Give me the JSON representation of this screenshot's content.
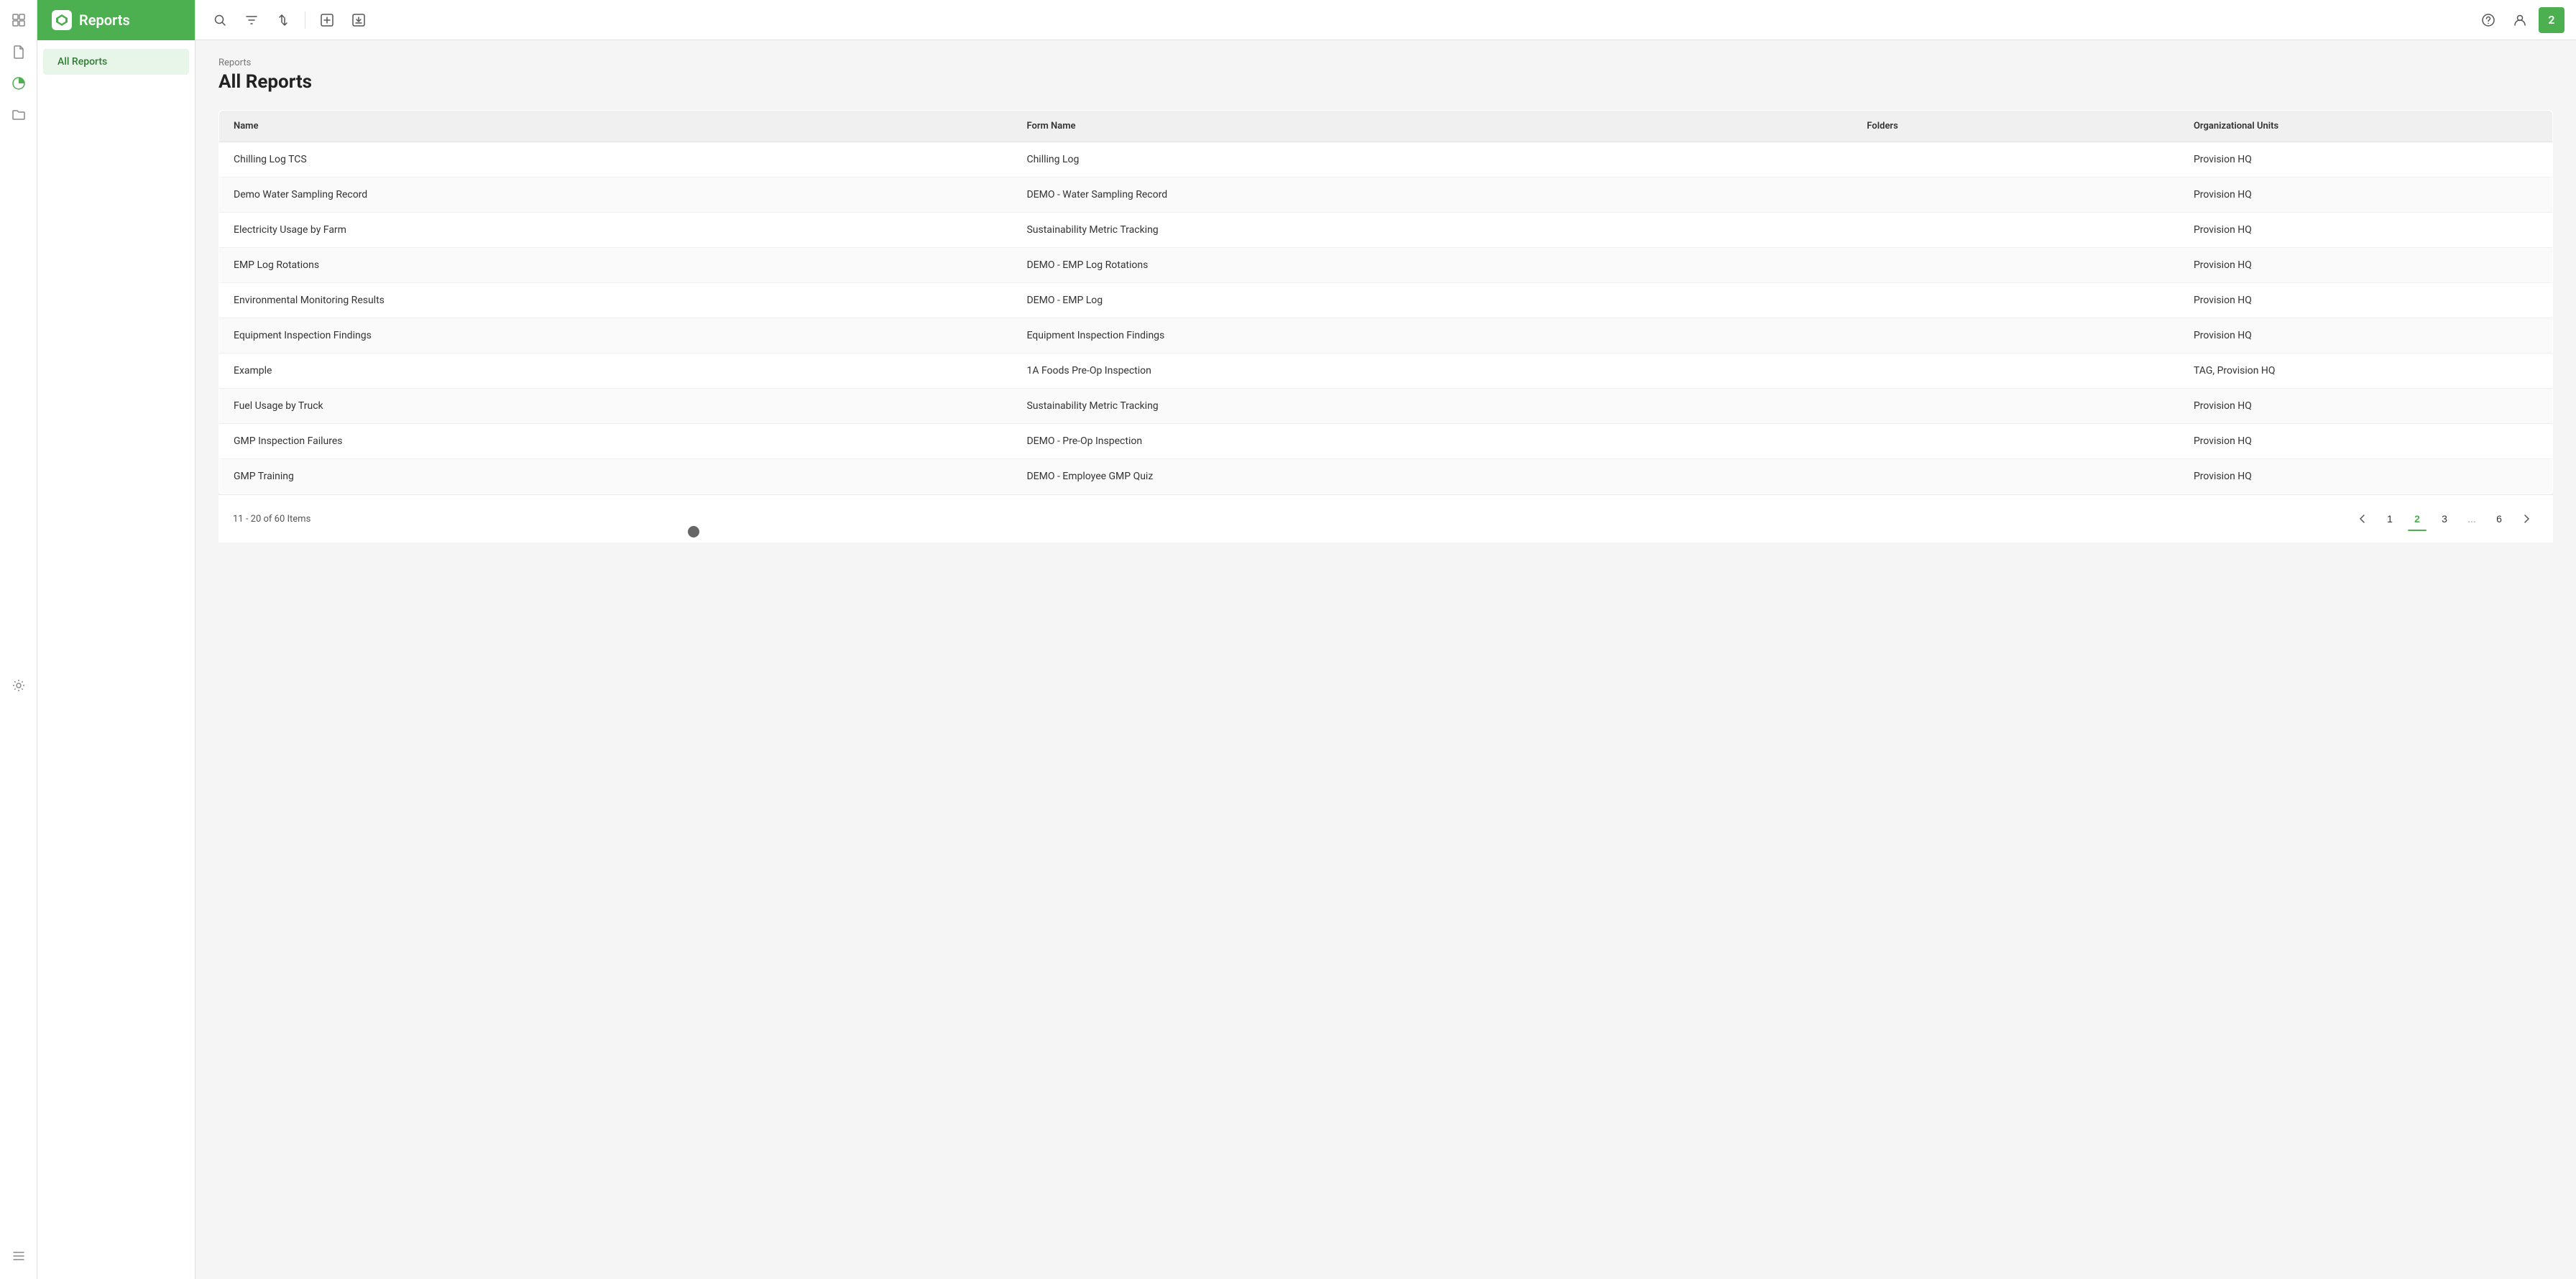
{
  "app": {
    "title": "Reports",
    "badge": "2"
  },
  "breadcrumb": "Reports",
  "page_title": "All Reports",
  "nav": {
    "items": [
      {
        "id": "all-reports",
        "label": "All Reports",
        "active": true
      }
    ]
  },
  "toolbar": {
    "search_tooltip": "Search",
    "filter_tooltip": "Filter",
    "sort_tooltip": "Sort",
    "add_tooltip": "Add",
    "export_tooltip": "Export",
    "help_tooltip": "Help",
    "user_tooltip": "User"
  },
  "table": {
    "columns": [
      "Name",
      "Form Name",
      "Folders",
      "Organizational Units"
    ],
    "rows": [
      {
        "name": "Chilling Log TCS",
        "form_name": "Chilling Log",
        "folders": "",
        "org_units": "Provision HQ"
      },
      {
        "name": "Demo Water Sampling Record",
        "form_name": "DEMO - Water Sampling Record",
        "folders": "",
        "org_units": "Provision HQ"
      },
      {
        "name": "Electricity Usage by Farm",
        "form_name": "Sustainability Metric Tracking",
        "folders": "",
        "org_units": "Provision HQ"
      },
      {
        "name": "EMP Log Rotations",
        "form_name": "DEMO - EMP Log Rotations",
        "folders": "",
        "org_units": "Provision HQ"
      },
      {
        "name": "Environmental Monitoring Results",
        "form_name": "DEMO - EMP Log",
        "folders": "",
        "org_units": "Provision HQ"
      },
      {
        "name": "Equipment Inspection Findings",
        "form_name": "Equipment Inspection Findings",
        "folders": "",
        "org_units": "Provision HQ"
      },
      {
        "name": "Example",
        "form_name": "1A Foods Pre-Op Inspection",
        "folders": "",
        "org_units": "TAG, Provision HQ"
      },
      {
        "name": "Fuel Usage by Truck",
        "form_name": "Sustainability Metric Tracking",
        "folders": "",
        "org_units": "Provision HQ"
      },
      {
        "name": "GMP Inspection Failures",
        "form_name": "DEMO - Pre-Op Inspection",
        "folders": "",
        "org_units": "Provision HQ"
      },
      {
        "name": "GMP Training",
        "form_name": "DEMO - Employee GMP Quiz",
        "folders": "",
        "org_units": "Provision HQ"
      }
    ]
  },
  "pagination": {
    "info": "11 - 20 of 60 Items",
    "pages": [
      "1",
      "2",
      "3",
      "...",
      "6"
    ],
    "current_page": "2",
    "prev_label": "‹",
    "next_label": "›"
  },
  "sidebar_icons": {
    "items": [
      {
        "id": "dashboard",
        "icon": "⊞",
        "label": "Dashboard"
      },
      {
        "id": "document",
        "icon": "📄",
        "label": "Document"
      },
      {
        "id": "reports",
        "icon": "◑",
        "label": "Reports",
        "active": true
      },
      {
        "id": "folder",
        "icon": "📁",
        "label": "Folder"
      },
      {
        "id": "settings",
        "icon": "⚙",
        "label": "Settings"
      },
      {
        "id": "menu",
        "icon": "☰",
        "label": "Menu"
      }
    ]
  }
}
